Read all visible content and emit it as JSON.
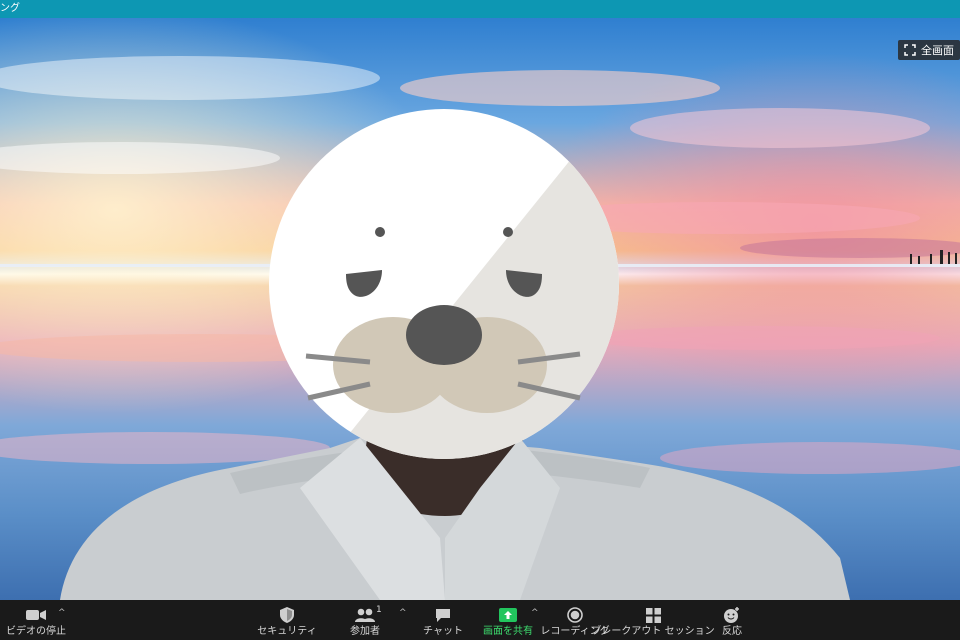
{
  "window": {
    "title": "ング"
  },
  "video": {
    "fullscreen_label": "全画面",
    "avatar_icon": "seal-face-icon"
  },
  "toolbar": {
    "video_stop": "ビデオの停止",
    "security": "セキュリティ",
    "participants": "参加者",
    "participants_count": "1",
    "chat": "チャット",
    "share_screen": "画面を共有",
    "recording": "レコーディング",
    "breakout": "ブレークアウト セッション",
    "reactions": "反応"
  },
  "colors": {
    "titlebar": "#0d97b3",
    "toolbar_bg": "#1a1a1a",
    "share_green": "#22c55e"
  }
}
